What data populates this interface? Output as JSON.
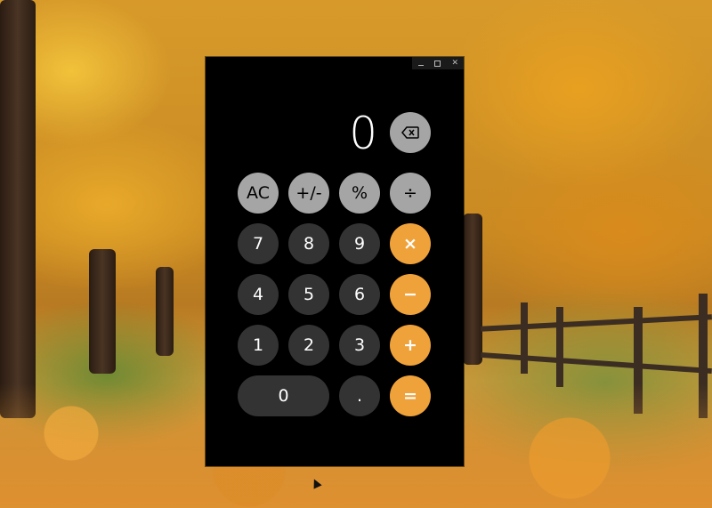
{
  "calculator": {
    "display_value": "0",
    "keys": {
      "ac": "AC",
      "plus_minus": "+/-",
      "percent": "%",
      "divide": "÷",
      "seven": "7",
      "eight": "8",
      "nine": "9",
      "multiply": "×",
      "four": "4",
      "five": "5",
      "six": "6",
      "minus": "−",
      "one": "1",
      "two": "2",
      "three": "3",
      "plus": "+",
      "zero": "0",
      "decimal": ".",
      "equals": "="
    }
  },
  "titlebar": {
    "close_glyph": "✕"
  },
  "colors": {
    "function_key": "#a5a5a5",
    "number_key": "#333333",
    "operator_key": "#f0a23a",
    "window_bg": "#000000"
  },
  "icons": {
    "backspace": "backspace-icon",
    "minimize": "minimize-icon",
    "maximize": "maximize-icon",
    "close": "close-icon"
  }
}
